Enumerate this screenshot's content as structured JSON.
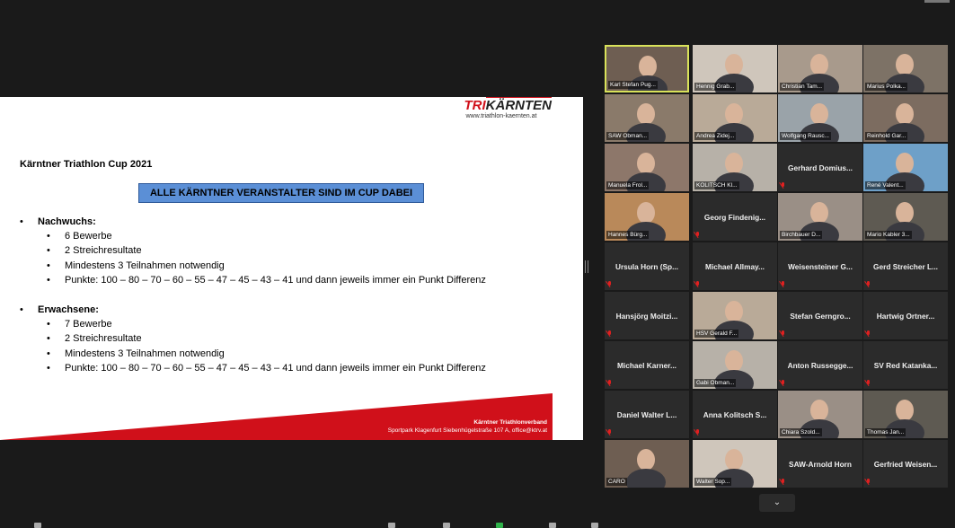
{
  "slide": {
    "logo_tri": "TRI",
    "logo_rest": "KÄRNTEN",
    "logo_url": "www.triathlon-kaernten.at",
    "title": "Kärntner Triathlon Cup 2021",
    "banner": "ALLE KÄRNTNER VERANSTALTER SIND IM CUP DABEI",
    "sections": [
      {
        "head": "Nachwuchs:",
        "items": [
          "6 Bewerbe",
          "2 Streichresultate",
          "Mindestens 3 Teilnahmen notwendig",
          "Punkte: 100 – 80 – 70 – 60 – 55 – 47 – 45 – 43 – 41 und dann jeweils immer ein Punkt Differenz"
        ]
      },
      {
        "head": "Erwachsene:",
        "items": [
          "7 Bewerbe",
          "2 Streichresultate",
          "Mindestens 3 Teilnahmen notwendig",
          "Punkte: 100 – 80 – 70 – 60 – 55 – 47 – 45 – 43 – 41 und dann jeweils immer ein Punkt Differenz"
        ]
      }
    ],
    "footer_org": "Kärntner Triathlonverband",
    "footer_addr": "Sportpark Klagenfurt Siebenhügelstraße 107 A, office@ktrv.at",
    "accent_color": "#d0101a",
    "banner_color": "#5b8fd6"
  },
  "gallery": {
    "participants": [
      {
        "name": "Karl Stefan Pug...",
        "video": true,
        "active": true
      },
      {
        "name": "Hennig Grab...",
        "video": true
      },
      {
        "name": "Christian Tam...",
        "video": true
      },
      {
        "name": "Marius Polka...",
        "video": true
      },
      {
        "name": "SAW Obman...",
        "video": true
      },
      {
        "name": "Andrea Zidej...",
        "video": true
      },
      {
        "name": "Wolfgang Rausc...",
        "video": true
      },
      {
        "name": "Reinhold Gar...",
        "video": true
      },
      {
        "name": "Manuela Frol...",
        "video": true
      },
      {
        "name": "KOLITSCH Kl...",
        "video": true
      },
      {
        "name": "Gerhard Domius...",
        "video": false
      },
      {
        "name": "René Valent...",
        "video": true
      },
      {
        "name": "Hannes Bürg...",
        "video": true
      },
      {
        "name": "Georg Findenig...",
        "video": false
      },
      {
        "name": "Birchbauer D...",
        "video": true
      },
      {
        "name": "Mario Kabler 3...",
        "video": true
      },
      {
        "name": "Ursula Horn (Sp...",
        "video": false
      },
      {
        "name": "Michael Allmay...",
        "video": false
      },
      {
        "name": "Weisensteiner G...",
        "video": false
      },
      {
        "name": "Gerd Streicher L...",
        "video": false
      },
      {
        "name": "Hansjörg Moitzi...",
        "video": false
      },
      {
        "name": "HSV Gerald F...",
        "video": true
      },
      {
        "name": "Stefan Gerngro...",
        "video": false
      },
      {
        "name": "Hartwig Ortner...",
        "video": false
      },
      {
        "name": "Michael Karner...",
        "video": false
      },
      {
        "name": "Gabi Obman...",
        "video": true
      },
      {
        "name": "Anton Russegge...",
        "video": false
      },
      {
        "name": "SV Red Katanka...",
        "video": false
      },
      {
        "name": "Daniel Walter L...",
        "video": false
      },
      {
        "name": "Anna Kolitsch S...",
        "video": false
      },
      {
        "name": "Chiara Szold...",
        "video": true
      },
      {
        "name": "Thomas Jan...",
        "video": true
      },
      {
        "name": "CARO",
        "video": true
      },
      {
        "name": "Walter Sop...",
        "video": true
      },
      {
        "name": "SAW-Arnold Horn",
        "video": false
      },
      {
        "name": "Gerfried Weisen...",
        "video": false
      }
    ]
  },
  "icons": {
    "scroll_down": "chevron-down-icon",
    "muted": "mic-muted-icon"
  }
}
